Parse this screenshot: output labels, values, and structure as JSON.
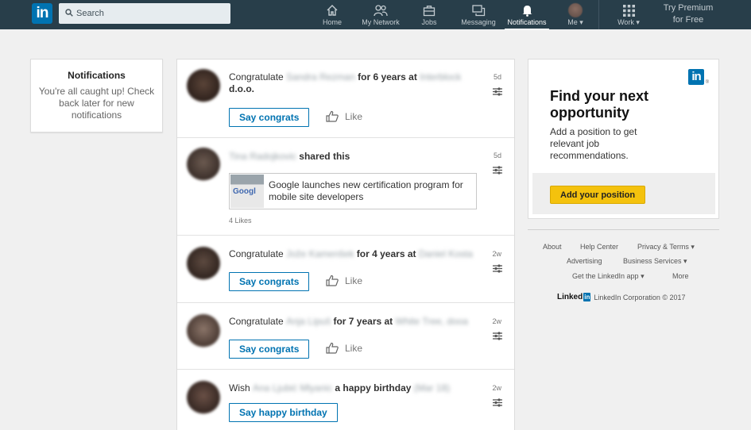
{
  "nav": {
    "logo_text": "in",
    "search_placeholder": "Search",
    "items": [
      {
        "label": "Home",
        "icon": "home-icon"
      },
      {
        "label": "My Network",
        "icon": "network-icon"
      },
      {
        "label": "Jobs",
        "icon": "jobs-icon"
      },
      {
        "label": "Messaging",
        "icon": "messaging-icon"
      },
      {
        "label": "Notifications",
        "icon": "bell-icon",
        "active": true
      },
      {
        "label": "Me ▾",
        "icon": "avatar"
      },
      {
        "label": "Work ▾",
        "icon": "grid-icon"
      }
    ],
    "premium_line1": "Try Premium",
    "premium_line2": "for Free"
  },
  "left_card": {
    "title": "Notifications",
    "message": "You're all caught up! Check back later for new notifications"
  },
  "feed": [
    {
      "prefix": "Congratulate",
      "name": "Sandra Rezman",
      "mid": "for 6 years at",
      "company": "Interblock",
      "suffix": "d.o.o.",
      "time": "5d",
      "button": "Say congrats",
      "like": "Like"
    },
    {
      "name": "Tina Radojkovic",
      "action": "shared this",
      "time": "5d",
      "link_title": "Google launches new certification program for mobile site developers",
      "thumb_text": "Googl",
      "likes": "4 Likes"
    },
    {
      "prefix": "Congratulate",
      "name": "Jože Kamenšek",
      "mid": "for 4 years at",
      "company": "Daniel Kosta",
      "time": "2w",
      "button": "Say congrats",
      "like": "Like"
    },
    {
      "prefix": "Congratulate",
      "name": "Anja Lipuš",
      "mid": "for 7 years at",
      "company": "White Tree, dooa",
      "time": "2w",
      "button": "Say congrats",
      "like": "Like"
    },
    {
      "prefix": "Wish",
      "name": "Ana Ljubić Mlyanic",
      "mid": "a happy birthday",
      "company": "(Mar 18)",
      "time": "2w",
      "button": "Say happy birthday"
    }
  ],
  "ad": {
    "title": "Find your next opportunity",
    "body": "Add a position to get relevant job recommendations.",
    "button": "Add your position",
    "logo_text": "in",
    "logo_reg": "®"
  },
  "footer": {
    "about": "About",
    "help": "Help Center",
    "privacy": "Privacy & Terms ▾",
    "advertising": "Advertising",
    "business": "Business Services ▾",
    "app": "Get the LinkedIn app ▾",
    "more": "More",
    "brand_word": "Linked",
    "brand_in": "in",
    "copyright": "LinkedIn Corporation © 2017"
  },
  "colors": {
    "nav": "#283e4a",
    "brand": "#0073b1",
    "cta": "#f4c20d"
  }
}
